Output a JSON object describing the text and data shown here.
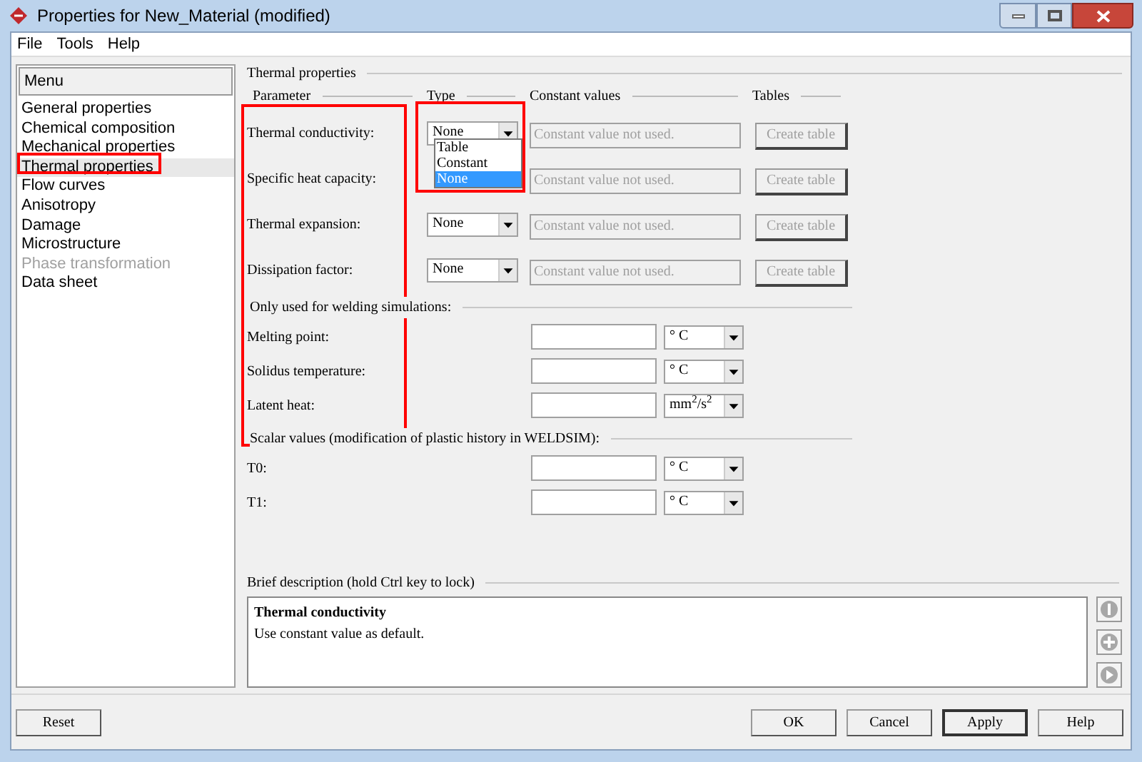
{
  "window": {
    "title": "Properties for New_Material (modified)"
  },
  "menu_bar": [
    "File",
    "Tools",
    "Help"
  ],
  "sidebar": {
    "title": "Menu",
    "items": [
      {
        "label": "General properties",
        "selected": false,
        "disabled": false
      },
      {
        "label": "Chemical composition",
        "selected": false,
        "disabled": false
      },
      {
        "label": "Mechanical properties",
        "selected": false,
        "disabled": false
      },
      {
        "label": "Thermal properties",
        "selected": true,
        "disabled": false
      },
      {
        "label": "Flow curves",
        "selected": false,
        "disabled": false
      },
      {
        "label": "Anisotropy",
        "selected": false,
        "disabled": false
      },
      {
        "label": "Damage",
        "selected": false,
        "disabled": false
      },
      {
        "label": "Microstructure",
        "selected": false,
        "disabled": false
      },
      {
        "label": "Phase transformation",
        "selected": false,
        "disabled": true
      },
      {
        "label": "Data sheet",
        "selected": false,
        "disabled": false
      }
    ]
  },
  "thermal_properties": {
    "title": "Thermal properties",
    "columns": [
      "Parameter",
      "Type",
      "Constant values",
      "Tables"
    ],
    "rows": [
      {
        "label": "Thermal conductivity:",
        "type": "None",
        "constant_placeholder": "Constant value not used.",
        "table_button": "Create table"
      },
      {
        "label": "Specific heat capacity:",
        "constant_placeholder": "Constant value not used.",
        "table_button": "Create table"
      },
      {
        "label": "Thermal expansion:",
        "type": "None",
        "constant_placeholder": "Constant value not used.",
        "table_button": "Create table"
      },
      {
        "label": "Dissipation factor:",
        "type": "None",
        "constant_placeholder": "Constant value not used.",
        "table_button": "Create table"
      }
    ],
    "type_dropdown": {
      "options": [
        {
          "label": "Table",
          "selected": false
        },
        {
          "label": "Constant",
          "selected": false
        },
        {
          "label": "None",
          "selected": true
        }
      ]
    }
  },
  "welding": {
    "title": "Only used for welding simulations:",
    "rows": [
      {
        "label": "Melting point:",
        "unit": "° C"
      },
      {
        "label": "Solidus temperature:",
        "unit": "° C"
      },
      {
        "label": "Latent heat:",
        "unit": "mm$^{2}$/s$^{2}$"
      }
    ]
  },
  "scalar_values": {
    "title": "Scalar values (modification of plastic history in WELDSIM):",
    "rows": [
      {
        "label": "T0:",
        "unit": "° C"
      },
      {
        "label": "T1:",
        "unit": "° C"
      }
    ]
  },
  "description": {
    "title": "Brief description (hold Ctrl key to lock)",
    "heading": "Thermal conductivity",
    "text": "Use constant value as default."
  },
  "buttons": {
    "left": "Reset",
    "right": [
      {
        "label": "OK",
        "focused": false
      },
      {
        "label": "Cancel",
        "focused": false
      },
      {
        "label": "Apply",
        "focused": true
      },
      {
        "label": "Help",
        "focused": false
      }
    ]
  }
}
